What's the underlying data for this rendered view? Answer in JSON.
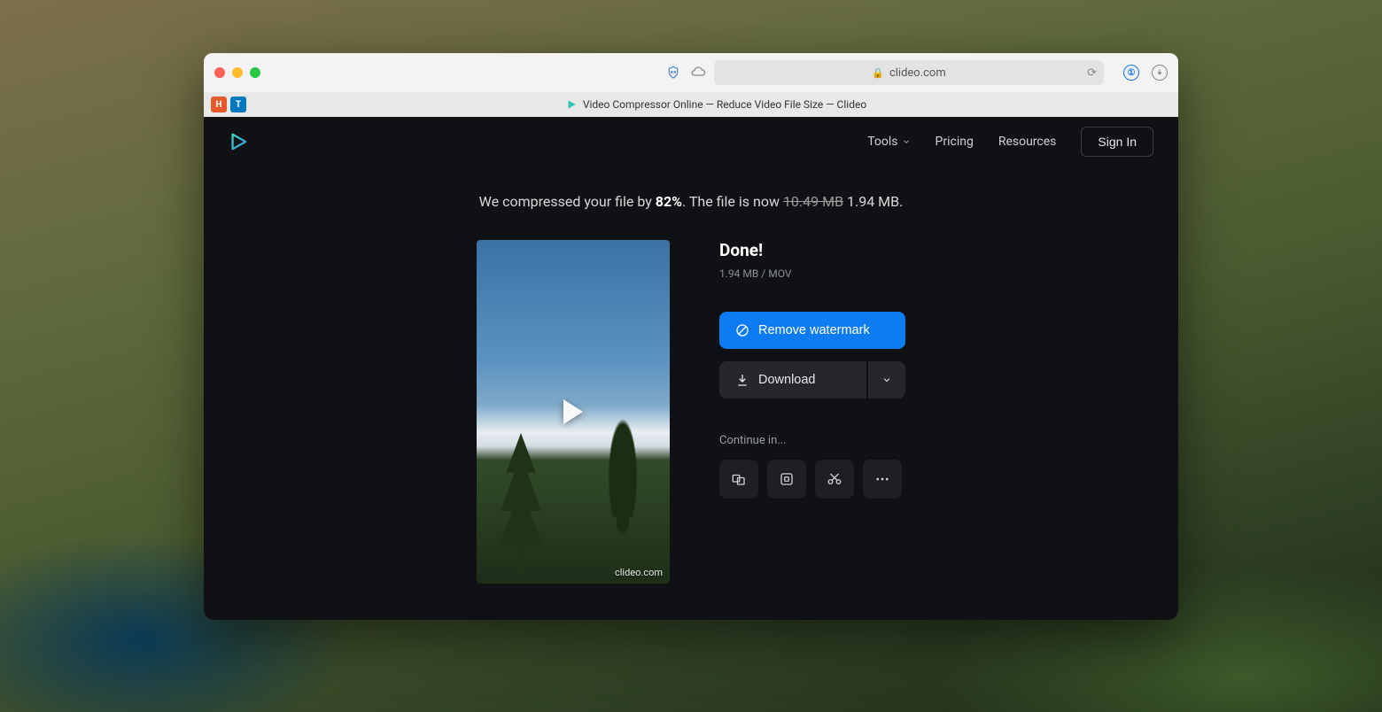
{
  "browser": {
    "url_host": "clideo.com",
    "tab_title": "Video Compressor Online — Reduce Video File Size — Clideo",
    "favorites": [
      "H",
      "T"
    ]
  },
  "nav": {
    "tools": "Tools",
    "pricing": "Pricing",
    "resources": "Resources",
    "signin": "Sign In"
  },
  "summary": {
    "prefix": "We compressed your file by ",
    "percent": "82%",
    "middle": ". The file is now ",
    "old_size": "10.49 MB",
    "new_size": " 1.94 MB."
  },
  "result": {
    "done": "Done!",
    "meta_size": "1.94 MB",
    "meta_sep": "  /  ",
    "meta_fmt": "MOV",
    "remove_watermark": "Remove watermark",
    "download": "Download",
    "continue": "Continue in...",
    "watermark_text": "clideo.com"
  }
}
